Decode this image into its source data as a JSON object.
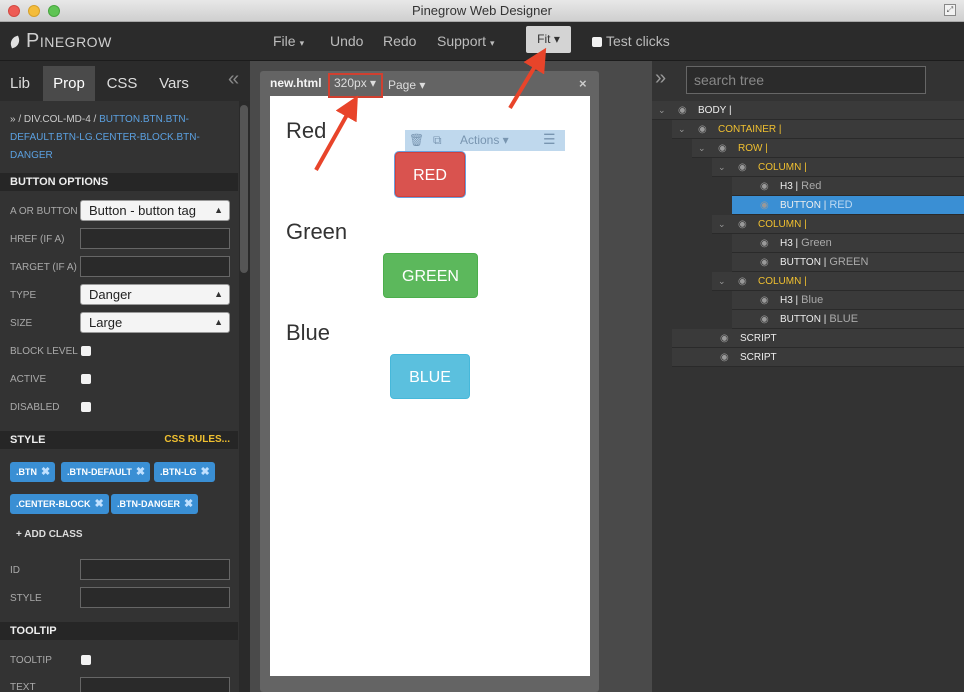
{
  "window": {
    "title": "Pinegrow Web Designer"
  },
  "menu": {
    "logo": "Pinegrow",
    "items": [
      {
        "label": "File",
        "caret": "▾"
      },
      {
        "label": "Undo"
      },
      {
        "label": "Redo"
      },
      {
        "label": "Support",
        "caret": "▾"
      }
    ],
    "fit": "Fit ▾",
    "test_clicks": "Test clicks"
  },
  "left": {
    "tabs": [
      "Lib",
      "Prop",
      "CSS",
      "Vars"
    ],
    "active_tab": "Prop",
    "breadcrumb": {
      "prefix": "» / div.col-md-4 / ",
      "current": "button.btn.btn-default.btn-lg.center-block.btn-danger"
    },
    "button_options": {
      "title": "BUTTON OPTIONS",
      "a_or_button": {
        "label": "A or Button",
        "value": "Button - button tag"
      },
      "href": {
        "label": "Href (if A)",
        "value": ""
      },
      "target": {
        "label": "Target (if A)",
        "value": ""
      },
      "type": {
        "label": "Type",
        "value": "Danger"
      },
      "size": {
        "label": "Size",
        "value": "Large"
      },
      "block_level": {
        "label": "Block level"
      },
      "active": {
        "label": "Active"
      },
      "disabled": {
        "label": "Disabled"
      }
    },
    "style": {
      "title": "STYLE",
      "css_rules": "CSS RULES...",
      "classes": [
        ".btn",
        ".btn-default",
        ".btn-lg",
        ".center-block",
        ".btn-danger"
      ],
      "add_class": "+ Add class",
      "id_label": "ID",
      "style_label": "Style"
    },
    "tooltip": {
      "title": "TOOLTIP",
      "tooltip_label": "Tooltip",
      "text_label": "Text"
    }
  },
  "center": {
    "file": "new.html",
    "size": "320px ▾",
    "page": "Page ▾",
    "close": "×",
    "action_bar": {
      "actions": "Actions ▾"
    },
    "content": [
      {
        "heading": "Red",
        "button": "RED"
      },
      {
        "heading": "Green",
        "button": "GREEN"
      },
      {
        "heading": "Blue",
        "button": "BLUE"
      }
    ]
  },
  "right": {
    "search_placeholder": "search tree",
    "tree": [
      {
        "tag": "BODY |",
        "detail": "",
        "style": "normal"
      },
      {
        "tag": "CONTAINER |",
        "detail": "",
        "style": "yellow"
      },
      {
        "tag": "ROW |",
        "detail": "",
        "style": "yellow"
      },
      {
        "tag": "COLUMN |",
        "detail": "",
        "style": "yellow"
      },
      {
        "tag": "H3 |",
        "detail": "Red",
        "style": "normal"
      },
      {
        "tag": "BUTTON |",
        "detail": "RED",
        "style": "selected"
      },
      {
        "tag": "COLUMN |",
        "detail": "",
        "style": "yellow"
      },
      {
        "tag": "H3 |",
        "detail": "Green",
        "style": "normal"
      },
      {
        "tag": "BUTTON |",
        "detail": "GREEN",
        "style": "normal"
      },
      {
        "tag": "COLUMN |",
        "detail": "",
        "style": "yellow"
      },
      {
        "tag": "H3 |",
        "detail": "Blue",
        "style": "normal"
      },
      {
        "tag": "BUTTON |",
        "detail": "BLUE",
        "style": "normal"
      },
      {
        "tag": "SCRIPT",
        "detail": "",
        "style": "normal"
      },
      {
        "tag": "SCRIPT",
        "detail": "",
        "style": "normal"
      }
    ]
  },
  "colors": {
    "accent": "#3a8fd4",
    "highlight": "#f0c030",
    "danger": "#d9534f",
    "success": "#5cb85c",
    "info": "#5bc0de",
    "annotation": "#e8442a"
  }
}
